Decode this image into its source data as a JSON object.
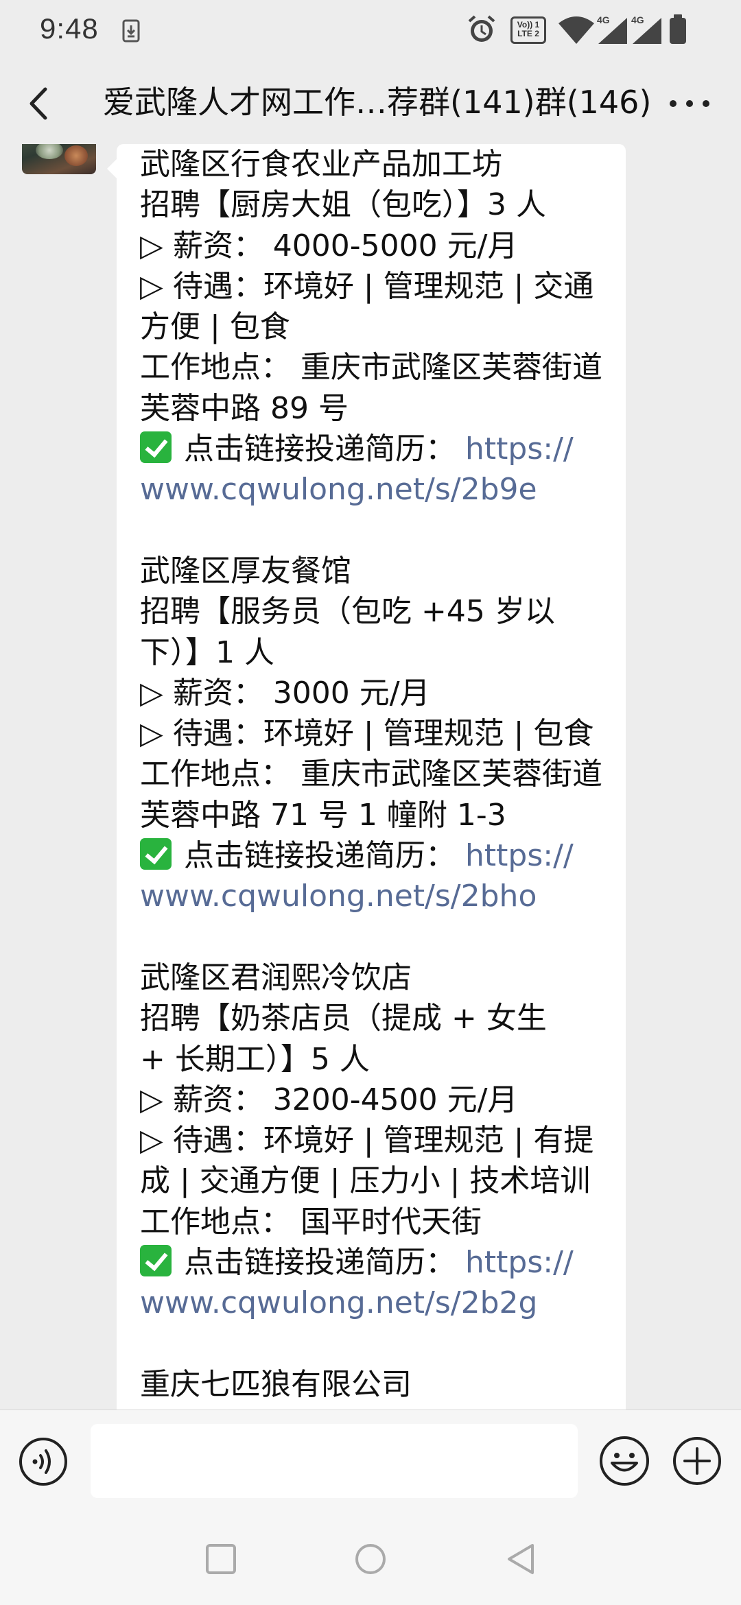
{
  "status_bar": {
    "time": "9:48",
    "icons": [
      "download-notification-icon",
      "alarm-icon",
      "volte-icon",
      "wifi-icon",
      "signal-4g-icon",
      "signal-4g-icon",
      "battery-icon"
    ],
    "volte_label": "Vo)) 1",
    "lte_label": "LTE 2",
    "network_label": "4G"
  },
  "title_bar": {
    "title": "爱武隆人才网工作…荐群(141)群(146)",
    "back_icon": "chevron-left-icon",
    "more_icon": "more-horizontal-icon"
  },
  "message": {
    "lines": [
      "武隆区行食农业产品加工坊",
      "招聘【厨房大姐（包吃）】3 人",
      "▷ 薪资： 4000-5000 元/月",
      "▷ 待遇：环境好 | 管理规范 | 交通",
      "方便 | 包食",
      "工作地点： 重庆市武隆区芙蓉街道",
      "芙蓉中路 89 号",
      "点击链接投递简历： ",
      "https://",
      "www.cqwulong.net/s/2b9e",
      "武隆区厚友餐馆",
      "招聘【服务员（包吃 +45 岁以",
      "下）】1 人",
      "▷ 薪资： 3000 元/月",
      "▷ 待遇：环境好 | 管理规范 | 包食",
      "工作地点： 重庆市武隆区芙蓉街道",
      "芙蓉中路 71 号 1 幢附 1-3",
      "点击链接投递简历： ",
      "https://",
      "www.cqwulong.net/s/2bho",
      "武隆区君润熙冷饮店",
      "招聘【奶茶店员（提成 + 女生",
      "+ 长期工）】5 人",
      "▷ 薪资： 3200-4500 元/月",
      "▷ 待遇：环境好 | 管理规范 | 有提",
      "成 | 交通方便 | 压力小 | 技术培训",
      "工作地点： 国平时代天街",
      "点击链接投递简历： ",
      "https://",
      "www.cqwulong.net/s/2b2g",
      "重庆七匹狼有限公司"
    ],
    "link_color": "#576b95",
    "check_color": "#29b33e"
  },
  "input_bar": {
    "voice_icon": "voice-icon",
    "emoji_icon": "emoji-icon",
    "plus_icon": "plus-circle-icon",
    "input_value": ""
  },
  "nav_bar": {
    "icons": [
      "recent-apps-icon",
      "home-icon",
      "back-triangle-icon"
    ]
  }
}
